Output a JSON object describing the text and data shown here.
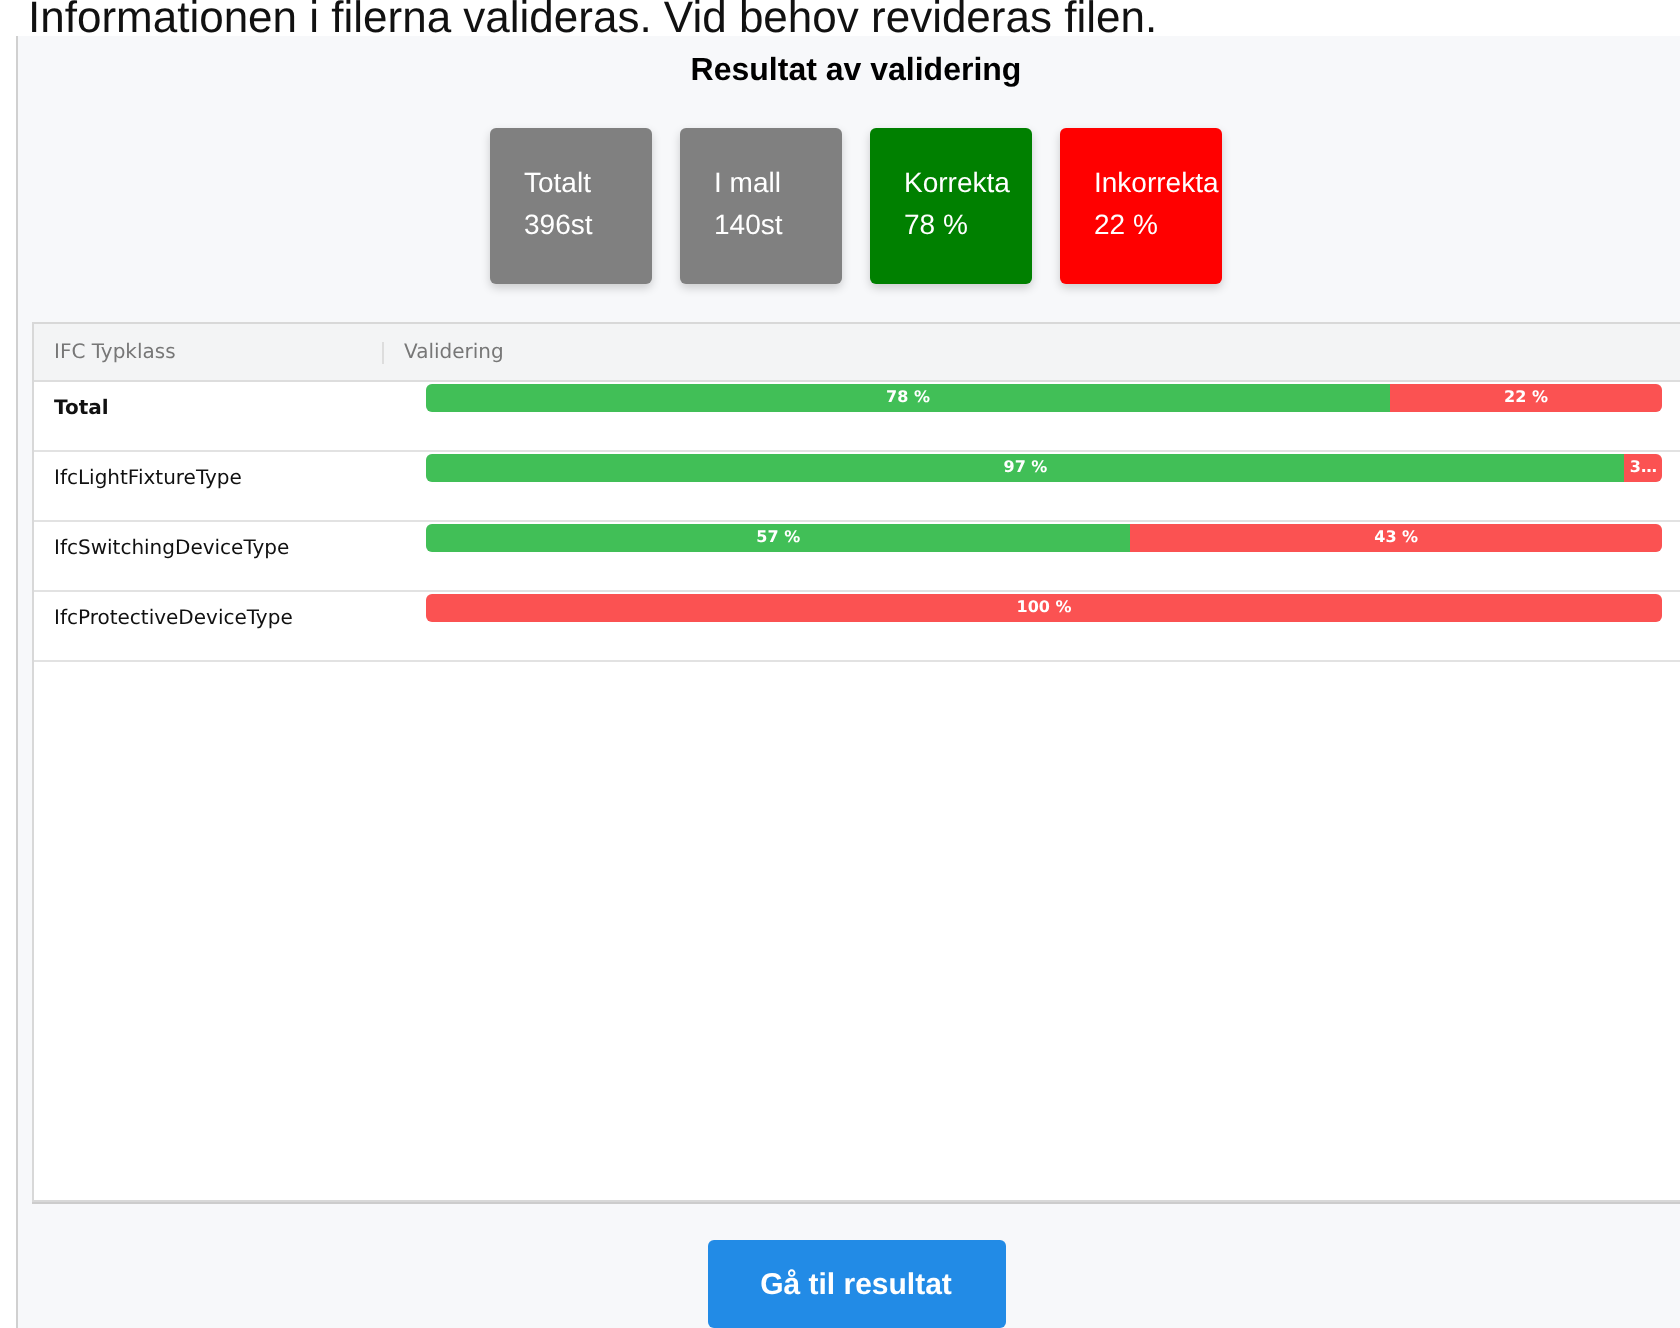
{
  "intro": "Informationen i filerna valideras. Vid behov revideras filen.",
  "title": "Resultat av validering",
  "cards": [
    {
      "label": "Totalt",
      "value": "396st",
      "color": "#808080"
    },
    {
      "label": "I mall",
      "value": "140st",
      "color": "#808080"
    },
    {
      "label": "Korrekta",
      "value": "78 %",
      "color": "#008000"
    },
    {
      "label": "Inkorrekta",
      "value": "22 %",
      "color": "#ff0000"
    }
  ],
  "table": {
    "columns": [
      "IFC Typklass",
      "Validering"
    ],
    "rows": [
      {
        "name": "Total",
        "kind": "total",
        "segments": [
          {
            "kind": "correct",
            "level": 0.78,
            "label": "78 %"
          },
          {
            "kind": "incorrect",
            "level": 0.22,
            "label": "22 %"
          }
        ]
      },
      {
        "name": "IfcLightFixtureType",
        "kind": "type",
        "segments": [
          {
            "kind": "correct",
            "level": 0.97,
            "label": "97 %"
          },
          {
            "kind": "incorrect",
            "level": 0.03,
            "label": "3…"
          }
        ]
      },
      {
        "name": "IfcSwitchingDeviceType",
        "kind": "type",
        "segments": [
          {
            "kind": "correct",
            "level": 0.57,
            "label": "57 %"
          },
          {
            "kind": "incorrect",
            "level": 0.43,
            "label": "43 %"
          }
        ]
      },
      {
        "name": "IfcProtectiveDeviceType",
        "kind": "type",
        "segments": [
          {
            "kind": "incorrect",
            "level": 1.0,
            "label": "100 %"
          }
        ]
      }
    ]
  },
  "button": "Gå til resultat"
}
